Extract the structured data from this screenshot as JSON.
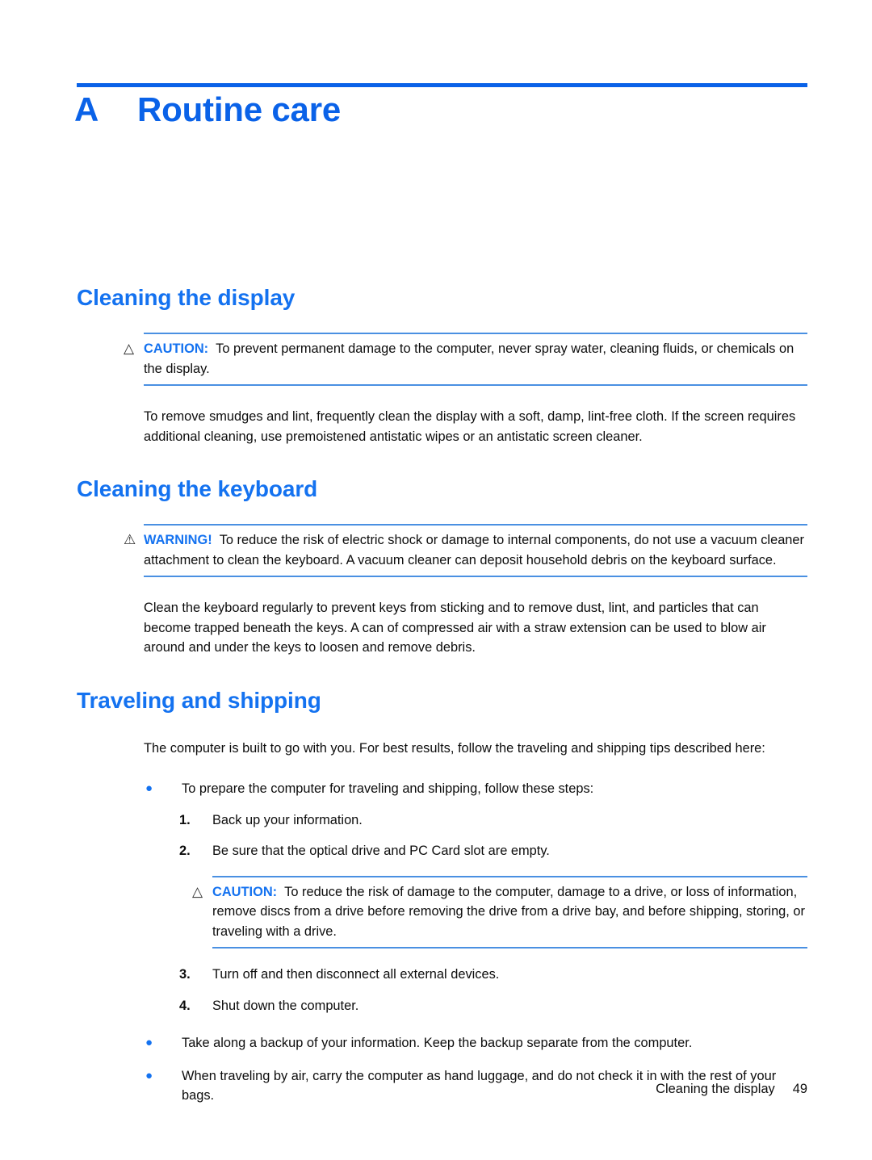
{
  "document": {
    "chapter_letter": "A",
    "chapter_title": "Routine care"
  },
  "sections": {
    "display": {
      "heading": "Cleaning the display",
      "caution": {
        "icon": "caution-triangle-icon",
        "label": "CAUTION:",
        "text": "To prevent permanent damage to the computer, never spray water, cleaning fluids, or chemicals on the display."
      },
      "paragraph": "To remove smudges and lint, frequently clean the display with a soft, damp, lint-free cloth. If the screen requires additional cleaning, use premoistened antistatic wipes or an antistatic screen cleaner."
    },
    "keyboard": {
      "heading": "Cleaning the keyboard",
      "warning": {
        "icon": "warning-triangle-icon",
        "label": "WARNING!",
        "text": "To reduce the risk of electric shock or damage to internal components, do not use a vacuum cleaner attachment to clean the keyboard. A vacuum cleaner can deposit household debris on the keyboard surface."
      },
      "paragraph": "Clean the keyboard regularly to prevent keys from sticking and to remove dust, lint, and particles that can become trapped beneath the keys. A can of compressed air with a straw extension can be used to blow air around and under the keys to loosen and remove debris."
    },
    "traveling": {
      "heading": "Traveling and shipping",
      "intro": "The computer is built to go with you. For best results, follow the traveling and shipping tips described here:",
      "bullet1": {
        "marker": "●",
        "text": "To prepare the computer for traveling and shipping, follow these steps:"
      },
      "steps": [
        {
          "marker": "1.",
          "text": "Back up your information."
        },
        {
          "marker": "2.",
          "text": "Be sure that the optical drive and PC Card slot are empty."
        },
        {
          "marker": "3.",
          "text": "Turn off and then disconnect all external devices."
        },
        {
          "marker": "4.",
          "text": "Shut down the computer."
        }
      ],
      "caution": {
        "icon": "caution-triangle-icon",
        "label": "CAUTION:",
        "text": "To reduce the risk of damage to the computer, damage to a drive, or loss of information, remove discs from a drive before removing the drive from a drive bay, and before shipping, storing, or traveling with a drive."
      },
      "bullet2": {
        "marker": "●",
        "text": "Take along a backup of your information. Keep the backup separate from the computer."
      },
      "bullet3": {
        "marker": "●",
        "text": "When traveling by air, carry the computer as hand luggage, and do not check it in with the rest of your bags."
      }
    }
  },
  "footer": {
    "running_head": "Cleaning the display",
    "page_number": "49"
  },
  "icons": {
    "caution_triangle": "△",
    "warning_triangle": "⚠"
  },
  "colors": {
    "heading_blue": "#1472f0",
    "rule_blue": "#0a62e8",
    "note_border": "#4a90e2",
    "body_black": "#0d0d0d"
  }
}
